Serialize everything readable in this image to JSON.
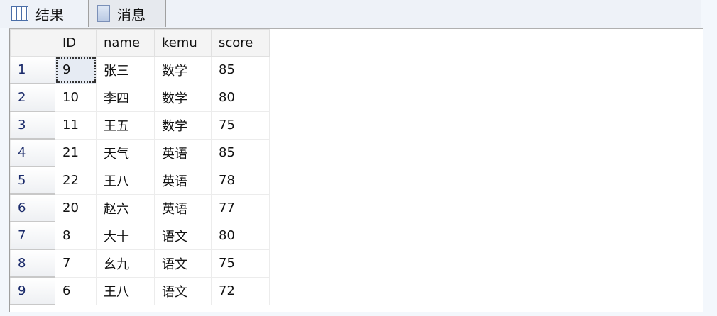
{
  "tabs": [
    {
      "label": "结果",
      "icon": "grid-icon"
    },
    {
      "label": "消息",
      "icon": "messages-icon"
    }
  ],
  "columns": [
    "ID",
    "name",
    "kemu",
    "score"
  ],
  "rows": [
    {
      "n": "1",
      "ID": "9",
      "name": "张三",
      "kemu": "数学",
      "score": "85"
    },
    {
      "n": "2",
      "ID": "10",
      "name": "李四",
      "kemu": "数学",
      "score": "80"
    },
    {
      "n": "3",
      "ID": "11",
      "name": "王五",
      "kemu": "数学",
      "score": "75"
    },
    {
      "n": "4",
      "ID": "21",
      "name": "天气",
      "kemu": "英语",
      "score": "85"
    },
    {
      "n": "5",
      "ID": "22",
      "name": "王八",
      "kemu": "英语",
      "score": "78"
    },
    {
      "n": "6",
      "ID": "20",
      "name": "赵六",
      "kemu": "英语",
      "score": "77"
    },
    {
      "n": "7",
      "ID": "8",
      "name": "大十",
      "kemu": "语文",
      "score": "80"
    },
    {
      "n": "8",
      "ID": "7",
      "name": "幺九",
      "kemu": "语文",
      "score": "75"
    },
    {
      "n": "9",
      "ID": "6",
      "name": "王八",
      "kemu": "语文",
      "score": "72"
    }
  ]
}
